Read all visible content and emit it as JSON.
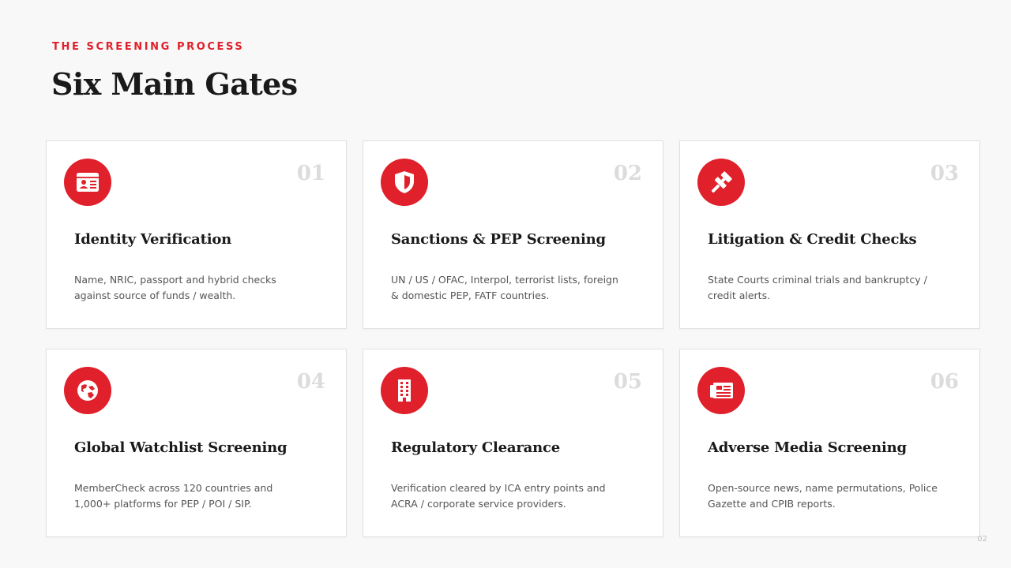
{
  "header": {
    "eyebrow": "THE SCREENING PROCESS",
    "title": "Six Main Gates"
  },
  "accent_color": "#e0202a",
  "cards": [
    {
      "number": "01",
      "icon": "id-card-icon",
      "title": "Identity Verification",
      "description": "Name, NRIC, passport and hybrid checks against source of funds / wealth."
    },
    {
      "number": "02",
      "icon": "shield-icon",
      "title": "Sanctions & PEP Screening",
      "description": "UN / US / OFAC, Interpol, terrorist lists, foreign & domestic PEP, FATF countries."
    },
    {
      "number": "03",
      "icon": "gavel-icon",
      "title": "Litigation & Credit Checks",
      "description": "State Courts criminal trials and bankruptcy / credit alerts."
    },
    {
      "number": "04",
      "icon": "globe-icon",
      "title": "Global Watchlist Screening",
      "description": "MemberCheck across 120 countries and 1,000+ platforms for PEP / POI / SIP."
    },
    {
      "number": "05",
      "icon": "building-icon",
      "title": "Regulatory Clearance",
      "description": "Verification cleared by ICA entry points and ACRA / corporate service providers."
    },
    {
      "number": "06",
      "icon": "newspaper-icon",
      "title": "Adverse Media Screening",
      "description": "Open-source news, name permutations, Police Gazette and CPIB reports."
    }
  ],
  "footer": {
    "page_number": "02"
  }
}
